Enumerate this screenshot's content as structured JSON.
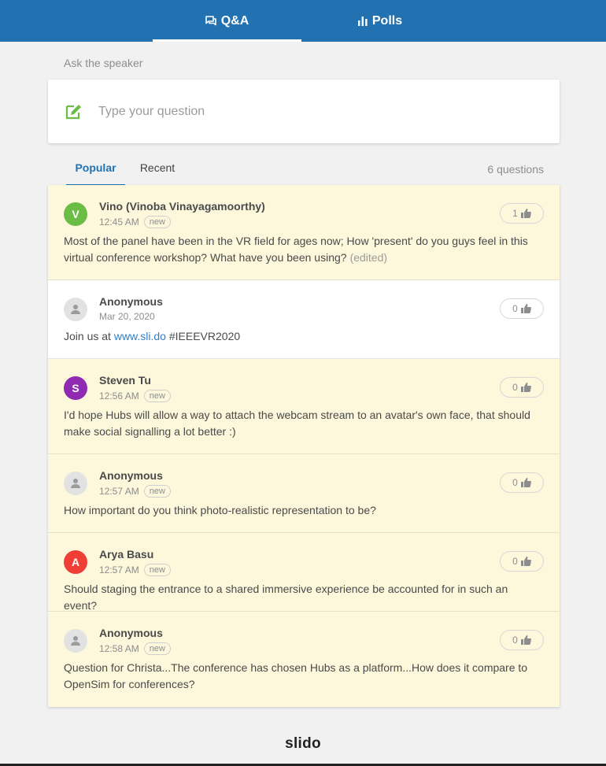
{
  "nav": {
    "tabs": [
      {
        "label": "Q&A",
        "icon": "chat-bubbles-icon",
        "active": true
      },
      {
        "label": "Polls",
        "icon": "bar-chart-icon",
        "active": false
      }
    ]
  },
  "ask": {
    "label": "Ask the speaker",
    "placeholder": "Type your question",
    "icon": "edit-note-icon"
  },
  "list_tabs": {
    "popular": "Popular",
    "recent": "Recent",
    "count": "6 questions"
  },
  "questions": [
    {
      "author": "Vino (Vinoba Vinayagamoorthy)",
      "initial": "V",
      "avatar_color": "#6cbd45",
      "time": "12:45 AM",
      "badge": "new",
      "likes": "1",
      "text": "Most of the panel have been in the VR field for ages now; How 'present' do you guys feel in this virtual conference workshop? What have you been using?",
      "edited": "(edited)"
    },
    {
      "author": "Anonymous",
      "initial": "",
      "avatar_color": "#e2e2e2",
      "time": "Mar 20, 2020",
      "badge": "",
      "likes": "0",
      "text_before": "Join us at",
      "link": "www.sli.do",
      "text_after": "#IEEEVR2020"
    },
    {
      "author": "Steven Tu",
      "initial": "S",
      "avatar_color": "#8f2ab3",
      "time": "12:56 AM",
      "badge": "new",
      "likes": "0",
      "text": "I'd hope Hubs will allow a way to attach the webcam stream to an avatar's own face, that should make social signalling a lot better :)"
    },
    {
      "author": "Anonymous",
      "initial": "",
      "avatar_color": "#e2e2e2",
      "time": "12:57 AM",
      "badge": "new",
      "likes": "0",
      "text": "How important do you think photo-realistic representation to be?"
    },
    {
      "author": "Arya Basu",
      "initial": "A",
      "avatar_color": "#ef3e36",
      "time": "12:57 AM",
      "badge": "new",
      "likes": "0",
      "text": "Should staging the entrance to a shared immersive experience be accounted for in such an event?"
    },
    {
      "author": "Anonymous",
      "initial": "",
      "avatar_color": "#e2e2e2",
      "time": "12:58 AM",
      "badge": "new",
      "likes": "0",
      "text": "Question for Christa...The conference has chosen Hubs as a platform...How does it compare to OpenSim for conferences?"
    }
  ],
  "footer": {
    "logo": "slido"
  },
  "colors": {
    "brand": "#2271b0",
    "highlight_bg": "#fdf7dc",
    "accent_green": "#6cbd45"
  }
}
